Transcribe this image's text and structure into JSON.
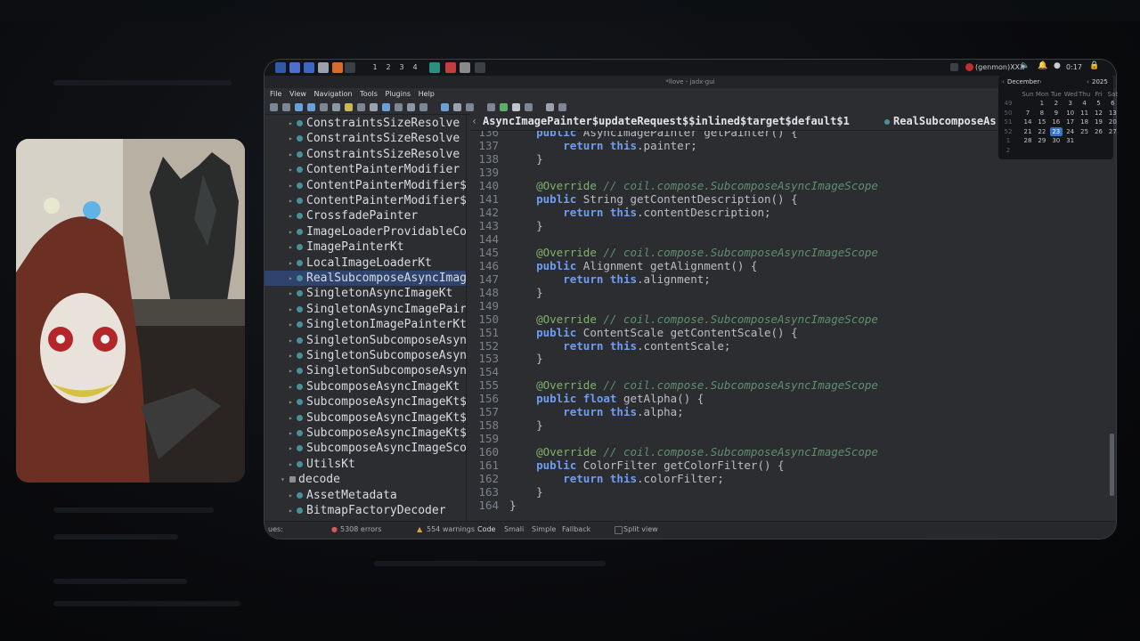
{
  "panel": {
    "workspaces": [
      "1",
      "2",
      "3",
      "4"
    ],
    "genmon": "(genmon)XXX",
    "clock": "0:17"
  },
  "window": {
    "title": "*llove - jadx-gui"
  },
  "menu": [
    "File",
    "View",
    "Navigation",
    "Tools",
    "Plugins",
    "Help"
  ],
  "tree": {
    "items": [
      {
        "label": "ConstraintsSizeResolve",
        "kind": "class",
        "arrow": "▸"
      },
      {
        "label": "ConstraintsSizeResolve",
        "kind": "class",
        "arrow": "▸"
      },
      {
        "label": "ConstraintsSizeResolve",
        "kind": "class",
        "arrow": "▸"
      },
      {
        "label": "ContentPainterModifier",
        "kind": "class",
        "arrow": "▸"
      },
      {
        "label": "ContentPainterModifier$",
        "kind": "class",
        "arrow": "▸"
      },
      {
        "label": "ContentPainterModifier$",
        "kind": "class",
        "arrow": "▸"
      },
      {
        "label": "CrossfadePainter",
        "kind": "class",
        "arrow": "▸"
      },
      {
        "label": "ImageLoaderProvidableCo",
        "kind": "class",
        "arrow": "▸"
      },
      {
        "label": "ImagePainterKt",
        "kind": "class",
        "arrow": "▸"
      },
      {
        "label": "LocalImageLoaderKt",
        "kind": "class",
        "arrow": "▸"
      },
      {
        "label": "RealSubcomposeAsyncImag",
        "kind": "class",
        "arrow": "▸",
        "selected": true
      },
      {
        "label": "SingletonAsyncImageKt",
        "kind": "class",
        "arrow": "▸"
      },
      {
        "label": "SingletonAsyncImagePair",
        "kind": "class",
        "arrow": "▸"
      },
      {
        "label": "SingletonImagePainterKt",
        "kind": "class",
        "arrow": "▸"
      },
      {
        "label": "SingletonSubcomposeAsyn",
        "kind": "class",
        "arrow": "▸"
      },
      {
        "label": "SingletonSubcomposeAsyn",
        "kind": "class",
        "arrow": "▸"
      },
      {
        "label": "SingletonSubcomposeAsyn",
        "kind": "class",
        "arrow": "▸"
      },
      {
        "label": "SubcomposeAsyncImageKt",
        "kind": "class",
        "arrow": "▸"
      },
      {
        "label": "SubcomposeAsyncImageKt$",
        "kind": "class",
        "arrow": "▸"
      },
      {
        "label": "SubcomposeAsyncImageKt$",
        "kind": "class",
        "arrow": "▸"
      },
      {
        "label": "SubcomposeAsyncImageKt$",
        "kind": "class",
        "arrow": "▸"
      },
      {
        "label": "SubcomposeAsyncImageSco",
        "kind": "class",
        "arrow": "▸"
      },
      {
        "label": "UtilsKt",
        "kind": "class",
        "arrow": "▸"
      },
      {
        "label": "decode",
        "kind": "package",
        "arrow": "▾"
      },
      {
        "label": "AssetMetadata",
        "kind": "class",
        "arrow": "▸"
      },
      {
        "label": "BitmapFactoryDecoder",
        "kind": "class",
        "arrow": "▸"
      }
    ]
  },
  "tabs": [
    {
      "label": "AsyncImagePainter$updateRequest$$inlined$target$default$1"
    },
    {
      "label": "RealSubcomposeAs"
    }
  ],
  "editor": {
    "lines": [
      {
        "n": "136",
        "segs": [
          [
            "    ",
            ""
          ],
          [
            "public",
            "kw"
          ],
          [
            " AsyncImagePainter getPainter() {",
            ""
          ]
        ]
      },
      {
        "n": "137",
        "segs": [
          [
            "        ",
            ""
          ],
          [
            "return",
            "kw"
          ],
          [
            " ",
            ""
          ],
          [
            "this",
            "kw"
          ],
          [
            ".painter;",
            ""
          ]
        ]
      },
      {
        "n": "138",
        "segs": [
          [
            "    }",
            ""
          ]
        ]
      },
      {
        "n": "139",
        "segs": [
          [
            "",
            ""
          ]
        ]
      },
      {
        "n": "140",
        "segs": [
          [
            "    ",
            ""
          ],
          [
            "@Override",
            "ann"
          ],
          [
            " // coil.compose.SubcomposeAsyncImageScope",
            "cm"
          ]
        ]
      },
      {
        "n": "141",
        "segs": [
          [
            "    ",
            ""
          ],
          [
            "public",
            "kw"
          ],
          [
            " String getContentDescription() {",
            ""
          ]
        ]
      },
      {
        "n": "142",
        "segs": [
          [
            "        ",
            ""
          ],
          [
            "return",
            "kw"
          ],
          [
            " ",
            ""
          ],
          [
            "this",
            "kw"
          ],
          [
            ".contentDescription;",
            ""
          ]
        ]
      },
      {
        "n": "143",
        "segs": [
          [
            "    }",
            ""
          ]
        ]
      },
      {
        "n": "144",
        "segs": [
          [
            "",
            ""
          ]
        ]
      },
      {
        "n": "145",
        "segs": [
          [
            "    ",
            ""
          ],
          [
            "@Override",
            "ann"
          ],
          [
            " // coil.compose.SubcomposeAsyncImageScope",
            "cm"
          ]
        ]
      },
      {
        "n": "146",
        "segs": [
          [
            "    ",
            ""
          ],
          [
            "public",
            "kw"
          ],
          [
            " Alignment getAlignment() {",
            ""
          ]
        ]
      },
      {
        "n": "147",
        "segs": [
          [
            "        ",
            ""
          ],
          [
            "return",
            "kw"
          ],
          [
            " ",
            ""
          ],
          [
            "this",
            "kw"
          ],
          [
            ".alignment;",
            ""
          ]
        ]
      },
      {
        "n": "148",
        "segs": [
          [
            "    }",
            ""
          ]
        ]
      },
      {
        "n": "149",
        "segs": [
          [
            "",
            ""
          ]
        ]
      },
      {
        "n": "150",
        "segs": [
          [
            "    ",
            ""
          ],
          [
            "@Override",
            "ann"
          ],
          [
            " // coil.compose.SubcomposeAsyncImageScope",
            "cm"
          ]
        ]
      },
      {
        "n": "151",
        "segs": [
          [
            "    ",
            ""
          ],
          [
            "public",
            "kw"
          ],
          [
            " ContentScale getContentScale() {",
            ""
          ]
        ]
      },
      {
        "n": "152",
        "segs": [
          [
            "        ",
            ""
          ],
          [
            "return",
            "kw"
          ],
          [
            " ",
            ""
          ],
          [
            "this",
            "kw"
          ],
          [
            ".contentScale;",
            ""
          ]
        ]
      },
      {
        "n": "153",
        "segs": [
          [
            "    }",
            ""
          ]
        ]
      },
      {
        "n": "154",
        "segs": [
          [
            "",
            ""
          ]
        ]
      },
      {
        "n": "155",
        "segs": [
          [
            "    ",
            ""
          ],
          [
            "@Override",
            "ann"
          ],
          [
            " // coil.compose.SubcomposeAsyncImageScope",
            "cm"
          ]
        ]
      },
      {
        "n": "156",
        "segs": [
          [
            "    ",
            ""
          ],
          [
            "public",
            "kw"
          ],
          [
            " ",
            ""
          ],
          [
            "float",
            "kw"
          ],
          [
            " getAlpha() {",
            ""
          ]
        ]
      },
      {
        "n": "157",
        "segs": [
          [
            "        ",
            ""
          ],
          [
            "return",
            "kw"
          ],
          [
            " ",
            ""
          ],
          [
            "this",
            "kw"
          ],
          [
            ".alpha;",
            ""
          ]
        ]
      },
      {
        "n": "158",
        "segs": [
          [
            "    }",
            ""
          ]
        ]
      },
      {
        "n": "159",
        "segs": [
          [
            "",
            ""
          ]
        ]
      },
      {
        "n": "160",
        "segs": [
          [
            "    ",
            ""
          ],
          [
            "@Override",
            "ann"
          ],
          [
            " // coil.compose.SubcomposeAsyncImageScope",
            "cm"
          ]
        ]
      },
      {
        "n": "161",
        "segs": [
          [
            "    ",
            ""
          ],
          [
            "public",
            "kw"
          ],
          [
            " ColorFilter getColorFilter() {",
            ""
          ]
        ]
      },
      {
        "n": "162",
        "segs": [
          [
            "        ",
            ""
          ],
          [
            "return",
            "kw"
          ],
          [
            " ",
            ""
          ],
          [
            "this",
            "kw"
          ],
          [
            ".colorFilter;",
            ""
          ]
        ]
      },
      {
        "n": "163",
        "segs": [
          [
            "    }",
            ""
          ]
        ]
      },
      {
        "n": "164",
        "segs": [
          [
            "}",
            ""
          ]
        ]
      }
    ]
  },
  "status": {
    "issues": "ues:",
    "errors": "5308 errors",
    "warnings": "554 warnings",
    "tabs": [
      "Code",
      "Smali",
      "Simple",
      "Fallback"
    ],
    "split": "Split view"
  },
  "calendar": {
    "month": "December",
    "year": "2025",
    "weekdays": [
      "Sun",
      "Mon",
      "Tue",
      "Wed",
      "Thu",
      "Fri",
      "Sat"
    ],
    "weeks": [
      {
        "wk": "49",
        "days": [
          "",
          "1",
          "2",
          "3",
          "4",
          "5",
          "6"
        ]
      },
      {
        "wk": "50",
        "days": [
          "7",
          "8",
          "9",
          "10",
          "11",
          "12",
          "13"
        ]
      },
      {
        "wk": "51",
        "days": [
          "14",
          "15",
          "16",
          "17",
          "18",
          "19",
          "20"
        ]
      },
      {
        "wk": "52",
        "days": [
          "21",
          "22",
          "23",
          "24",
          "25",
          "26",
          "27"
        ]
      },
      {
        "wk": "1",
        "days": [
          "28",
          "29",
          "30",
          "31",
          "",
          "",
          ""
        ]
      },
      {
        "wk": "2",
        "days": [
          "",
          "",
          "",
          "",
          "",
          "",
          ""
        ]
      }
    ],
    "today": "23"
  },
  "colors": {
    "keyword": "#6f9cf2",
    "annotation": "#7fb26a",
    "comment": "#5f8f6f",
    "selection": "#2e436e",
    "today": "#3574c8"
  }
}
